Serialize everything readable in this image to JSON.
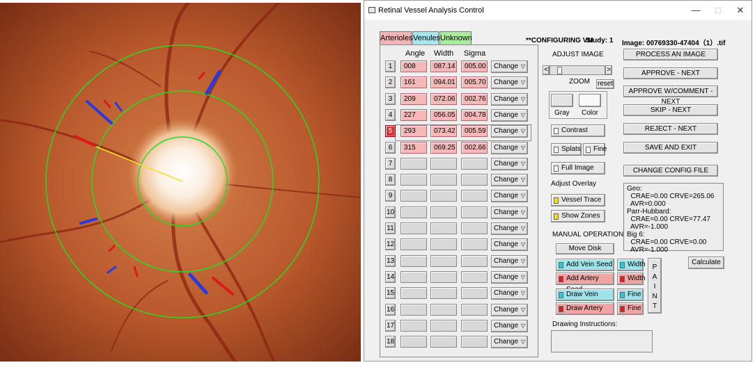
{
  "window": {
    "title": "Retinal Vessel Analysis Control",
    "controls": {
      "minimize": "—",
      "maximize": "□",
      "close": "✕"
    }
  },
  "tabs": [
    "Arterioles",
    "Venules",
    "Unknown"
  ],
  "status": {
    "mode": "**CONFIGURING VM",
    "study": "Study: 1",
    "image": "Image: 00769330-47404（1）.tif"
  },
  "table": {
    "headers": [
      "Angle",
      "Width",
      "Sigma"
    ],
    "change_label": "Change",
    "rows": [
      {
        "num": "1",
        "angle": "008",
        "width": "087.14",
        "sigma": "005.00"
      },
      {
        "num": "2",
        "angle": "161",
        "width": "094.01",
        "sigma": "005.70"
      },
      {
        "num": "3",
        "angle": "209",
        "width": "072.06",
        "sigma": "002.76"
      },
      {
        "num": "4",
        "angle": "227",
        "width": "056.05",
        "sigma": "004.78"
      },
      {
        "num": "5",
        "angle": "293",
        "width": "073.42",
        "sigma": "005.59"
      },
      {
        "num": "6",
        "angle": "315",
        "width": "069.25",
        "sigma": "002.66"
      },
      {
        "num": "7",
        "angle": "",
        "width": "",
        "sigma": ""
      },
      {
        "num": "8",
        "angle": "",
        "width": "",
        "sigma": ""
      },
      {
        "num": "9",
        "angle": "",
        "width": "",
        "sigma": ""
      },
      {
        "num": "10",
        "angle": "",
        "width": "",
        "sigma": ""
      },
      {
        "num": "11",
        "angle": "",
        "width": "",
        "sigma": ""
      },
      {
        "num": "12",
        "angle": "",
        "width": "",
        "sigma": ""
      },
      {
        "num": "13",
        "angle": "",
        "width": "",
        "sigma": ""
      },
      {
        "num": "14",
        "angle": "",
        "width": "",
        "sigma": ""
      },
      {
        "num": "15",
        "angle": "",
        "width": "",
        "sigma": ""
      },
      {
        "num": "16",
        "angle": "",
        "width": "",
        "sigma": ""
      },
      {
        "num": "17",
        "angle": "",
        "width": "",
        "sigma": ""
      },
      {
        "num": "18",
        "angle": "",
        "width": "",
        "sigma": ""
      }
    ],
    "selected_row": 5
  },
  "adjust_image": {
    "label": "ADJUST IMAGE",
    "zoom_label": "ZOOM",
    "reset_label": "reset",
    "left_arrow": "<",
    "right_arrow": ">",
    "gray_label": "Gray",
    "color_label": "Color",
    "contrast_label": "Contrast",
    "splats_label": "Splats",
    "fine_label": "Fine",
    "full_image_label": "Full Image"
  },
  "overlay": {
    "label": "Adjust Overlay",
    "vessel_trace": "Vessel Trace",
    "show_zones": "Show Zones"
  },
  "manual": {
    "label": "MANUAL OPERATIONS",
    "move_disk": "Move Disk",
    "add_vein_seed": "Add Vein Seed",
    "add_artery_seed": "Add Artery Seed",
    "draw_vein": "Draw Vein",
    "draw_artery": "Draw Artery",
    "width": "Width",
    "fine": "Fine",
    "paint": [
      "P",
      "A",
      "I",
      "N",
      "T"
    ],
    "drawing_instructions": "Drawing Instructions:"
  },
  "actions": {
    "process": "PROCESS AN IMAGE",
    "approve_next": "APPROVE - NEXT",
    "approve_comment": "APPROVE W/COMMENT - NEXT",
    "skip": "SKIP - NEXT",
    "reject": "REJECT - NEXT",
    "save_exit": "SAVE AND EXIT",
    "change_config": "CHANGE CONFIG FILE",
    "calculate": "Calculate"
  },
  "results": [
    "Geo:",
    "  CRAE=0.00 CRVE=265.06",
    "  AVR=0.000",
    "Parr-Hubbard:",
    "  CRAE=0.00 CRVE=77.47",
    "  AVR=-1.000",
    "Big 6:",
    "  CRAE=0.00 CRVE=0.00",
    "  AVR=-1.000"
  ],
  "colors": {
    "artery": "#e01818",
    "vein": "#2a3ae0",
    "zone": "#22dd22",
    "filled_cell": "#f4b8b8",
    "tab_arterioles": "#f2b4b4",
    "tab_venules": "#a8e6ee",
    "tab_unknown": "#a8ec9c"
  }
}
